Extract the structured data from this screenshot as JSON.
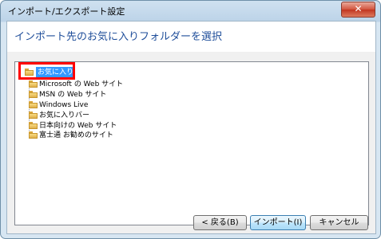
{
  "window": {
    "title": "インポート/エクスポート設定",
    "close_label": "✕"
  },
  "header": {
    "heading": "インポート先のお気に入りフォルダーを選択"
  },
  "tree": {
    "root": "お気に入り",
    "children": [
      "Microsoft の Web サイト",
      "MSN の Web サイト",
      "Windows Live",
      "お気に入りバー",
      "日本向けの Web サイト",
      "富士通 お勧めのサイト"
    ]
  },
  "buttons": {
    "back": "< 戻る(B)",
    "import": "インポート(I)",
    "cancel": "キャンセル"
  }
}
